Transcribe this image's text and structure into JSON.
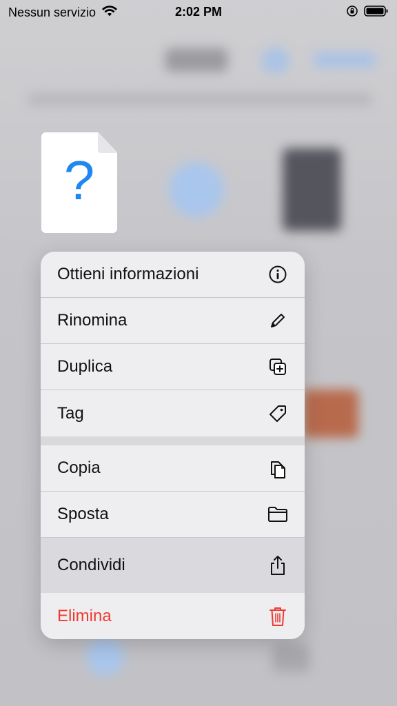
{
  "status_bar": {
    "carrier": "Nessun servizio",
    "time": "2:02 PM"
  },
  "preview": {
    "glyph": "?",
    "icon": "unknown-file-icon"
  },
  "menu": {
    "items": [
      {
        "label": "Ottieni informazioni",
        "icon": "info-icon"
      },
      {
        "label": "Rinomina",
        "icon": "pencil-icon"
      },
      {
        "label": "Duplica",
        "icon": "duplicate-icon"
      },
      {
        "label": "Tag",
        "icon": "tag-icon"
      },
      {
        "label": "Copia",
        "icon": "copy-icon"
      },
      {
        "label": "Sposta",
        "icon": "folder-icon"
      },
      {
        "label": "Condividi",
        "icon": "share-icon"
      },
      {
        "label": "Elimina",
        "icon": "trash-icon",
        "destructive": true
      }
    ]
  },
  "colors": {
    "destructive": "#ee3b32",
    "accent": "#1e88f0"
  }
}
